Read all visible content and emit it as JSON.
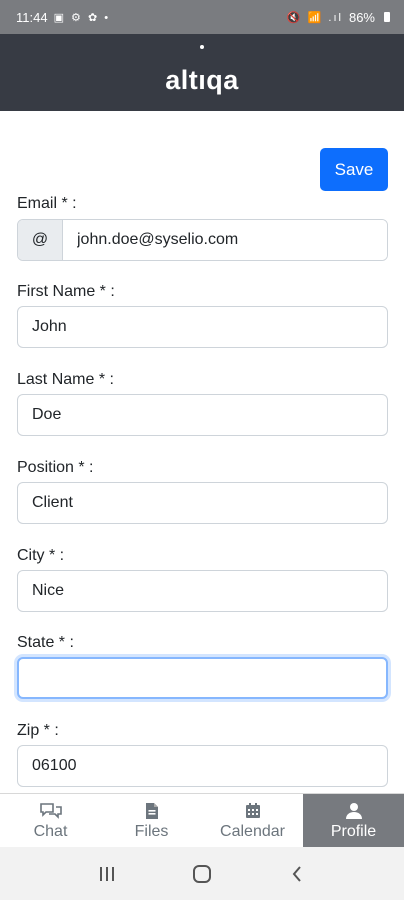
{
  "status_bar": {
    "time": "11:44",
    "left_icons": "▣ ⚙ ✿ •",
    "right_icons": "🔇 📶 .ıl",
    "battery": "86%"
  },
  "header": {
    "logo_text": "altıqa"
  },
  "toolbar": {
    "save_label": "Save"
  },
  "form": {
    "email": {
      "label": "Email * :",
      "prefix": "@",
      "value": "john.doe@syselio.com"
    },
    "first_name": {
      "label": "First Name * :",
      "value": "John"
    },
    "last_name": {
      "label": "Last Name * :",
      "value": "Doe"
    },
    "position": {
      "label": "Position * :",
      "value": "Client"
    },
    "city": {
      "label": "City * :",
      "value": "Nice"
    },
    "state": {
      "label": "State * :",
      "value": ""
    },
    "zip": {
      "label": "Zip * :",
      "value": "06100"
    }
  },
  "bottom_nav": {
    "items": [
      {
        "label": "Chat",
        "icon": "chat-icon",
        "active": false
      },
      {
        "label": "Files",
        "icon": "file-icon",
        "active": false
      },
      {
        "label": "Calendar",
        "icon": "calendar-icon",
        "active": false
      },
      {
        "label": "Profile",
        "icon": "user-icon",
        "active": true
      }
    ]
  },
  "colors": {
    "header_bg": "#373b44",
    "primary": "#0d6efd",
    "nav_active_bg": "#777a7f"
  }
}
